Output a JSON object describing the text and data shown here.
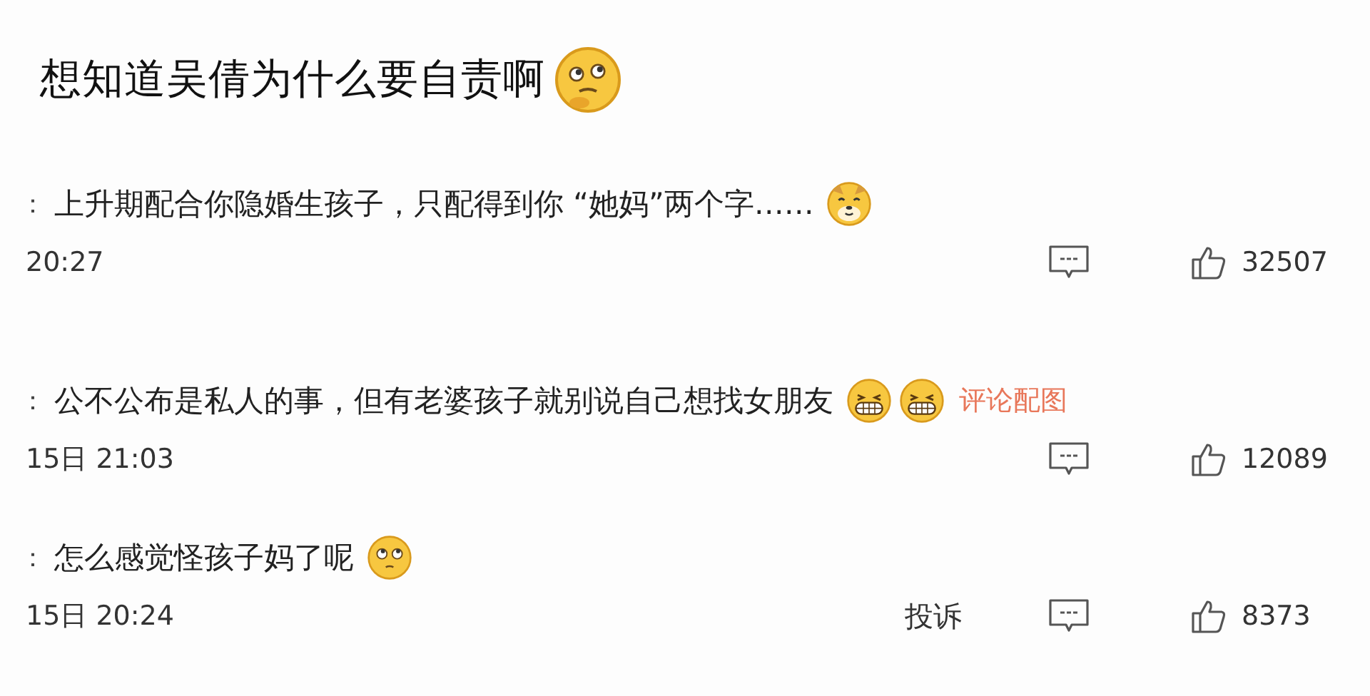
{
  "title": {
    "text": "想知道吴倩为什么要自责啊",
    "emoji": {
      "kind": "thinking"
    }
  },
  "comments": [
    {
      "lead": "：",
      "text": "上升期配合你隐婚生孩子，只配得到你 “她妈”两个字……",
      "emojis": [
        {
          "kind": "doge"
        }
      ],
      "time": "20:27",
      "likes": "32507"
    },
    {
      "lead": "：",
      "text": "公不公布是私人的事，但有老婆孩子就别说自己想找女朋友",
      "emojis": [
        {
          "kind": "grin"
        },
        {
          "kind": "grin"
        }
      ],
      "link": "评论配图",
      "time": "15日 21:03",
      "likes": "12089"
    },
    {
      "lead": "：",
      "text": "怎么感觉怪孩子妈了呢",
      "emojis": [
        {
          "kind": "eyeroll"
        }
      ],
      "time": "15日 20:24",
      "report": "投诉",
      "likes": "8373"
    }
  ]
}
